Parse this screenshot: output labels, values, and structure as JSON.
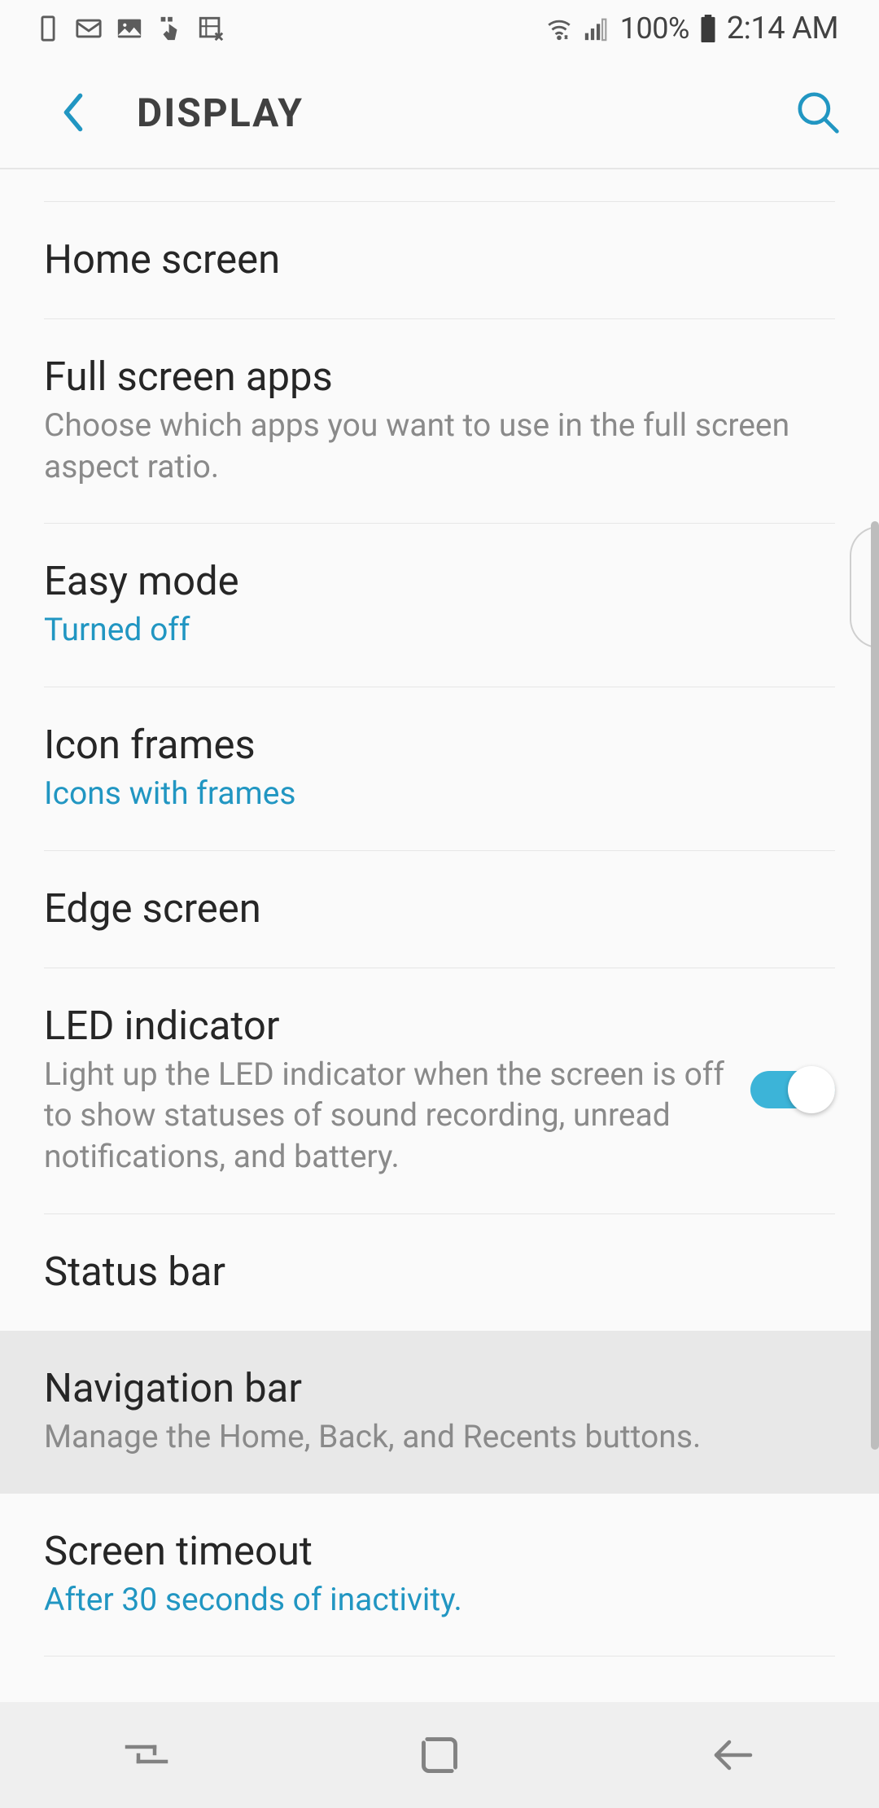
{
  "status": {
    "battery": "100%",
    "time": "2:14 AM"
  },
  "header": {
    "title": "DISPLAY"
  },
  "rows": {
    "home_screen": {
      "title": "Home screen"
    },
    "full_screen_apps": {
      "title": "Full screen apps",
      "sub": "Choose which apps you want to use in the full screen aspect ratio."
    },
    "easy_mode": {
      "title": "Easy mode",
      "sub": "Turned off"
    },
    "icon_frames": {
      "title": "Icon frames",
      "sub": "Icons with frames"
    },
    "edge_screen": {
      "title": "Edge screen"
    },
    "led_indicator": {
      "title": "LED indicator",
      "sub": "Light up the LED indicator when the screen is off to show statuses of sound recording, unread notifications, and battery.",
      "enabled": true
    },
    "status_bar": {
      "title": "Status bar"
    },
    "navigation_bar": {
      "title": "Navigation bar",
      "sub": "Manage the Home, Back, and Recents buttons."
    },
    "screen_timeout": {
      "title": "Screen timeout",
      "sub": "After 30 seconds of inactivity."
    }
  }
}
